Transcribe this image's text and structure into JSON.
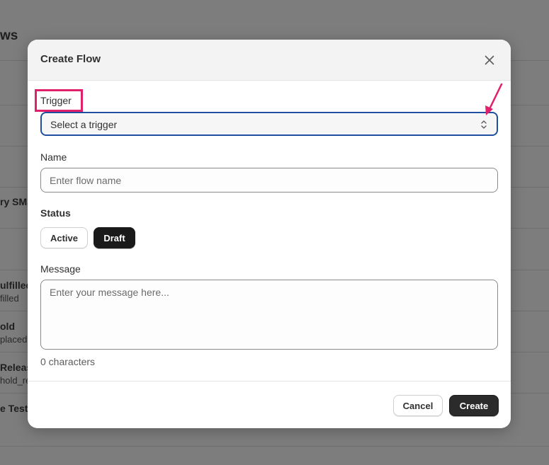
{
  "background": {
    "page_title": "ws",
    "rows": [
      {
        "title": "ry SMS",
        "sub": ""
      },
      {
        "title": "ulfilled",
        "sub": "filled"
      },
      {
        "title": "old",
        "sub": "placed"
      },
      {
        "title": "Releas",
        "sub": "hold_re"
      },
      {
        "title": "e Test",
        "sub": ""
      }
    ]
  },
  "modal": {
    "title": "Create Flow",
    "close_icon": "close-icon",
    "trigger": {
      "label": "Trigger",
      "value": "Select a trigger",
      "icon": "chevron-up-down-icon"
    },
    "name": {
      "label": "Name",
      "placeholder": "Enter flow name"
    },
    "status": {
      "label": "Status",
      "options": [
        "Active",
        "Draft"
      ],
      "selected": "Draft"
    },
    "message": {
      "label": "Message",
      "placeholder": "Enter your message here...",
      "char_count": "0 characters"
    },
    "footer": {
      "cancel_label": "Cancel",
      "create_label": "Create"
    }
  },
  "annotation": {
    "highlight_color": "#e0206a",
    "arrow_icon": "arrow-pointer-icon"
  },
  "colors": {
    "focus_border": "#1e4f9e",
    "primary_button": "#2b2b2b",
    "overlay": "#7d7d7d"
  }
}
